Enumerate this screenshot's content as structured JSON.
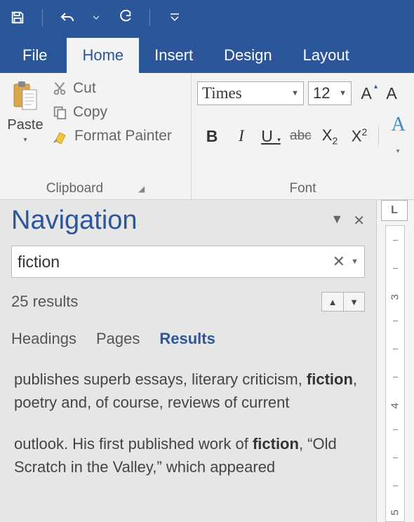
{
  "qat": {
    "save_icon": "save-icon",
    "undo_icon": "undo-icon",
    "redo_icon": "redo-icon"
  },
  "tabs": {
    "file": "File",
    "home": "Home",
    "insert": "Insert",
    "design": "Design",
    "layout": "Layout"
  },
  "clipboard": {
    "paste": "Paste",
    "cut": "Cut",
    "copy": "Copy",
    "format_painter": "Format Painter",
    "group_title": "Clipboard"
  },
  "font": {
    "font_name": "Times",
    "font_size": "12",
    "group_title": "Font",
    "bold": "B",
    "italic": "I",
    "underline": "U",
    "strike": "abc",
    "subscript": "X",
    "sub_sub": "2",
    "superscript": "X",
    "sup_sup": "2",
    "text_effects": "A",
    "grow_font": "A",
    "shrink_font": "A"
  },
  "navigation": {
    "title": "Navigation",
    "search_value": "fiction",
    "result_count": "25 results",
    "tabs": {
      "headings": "Headings",
      "pages": "Pages",
      "results": "Results"
    },
    "results": [
      {
        "pre": "publishes superb essays, literary criticism, ",
        "match": "fiction",
        "post": ", poetry and, of course, reviews of current"
      },
      {
        "pre": "outlook.  His first published work of ",
        "match": "fiction",
        "post": ", “Old Scratch in the Valley,” which appeared"
      }
    ]
  },
  "ruler": {
    "corner": "L",
    "marks": [
      "3",
      "4",
      "5"
    ]
  }
}
